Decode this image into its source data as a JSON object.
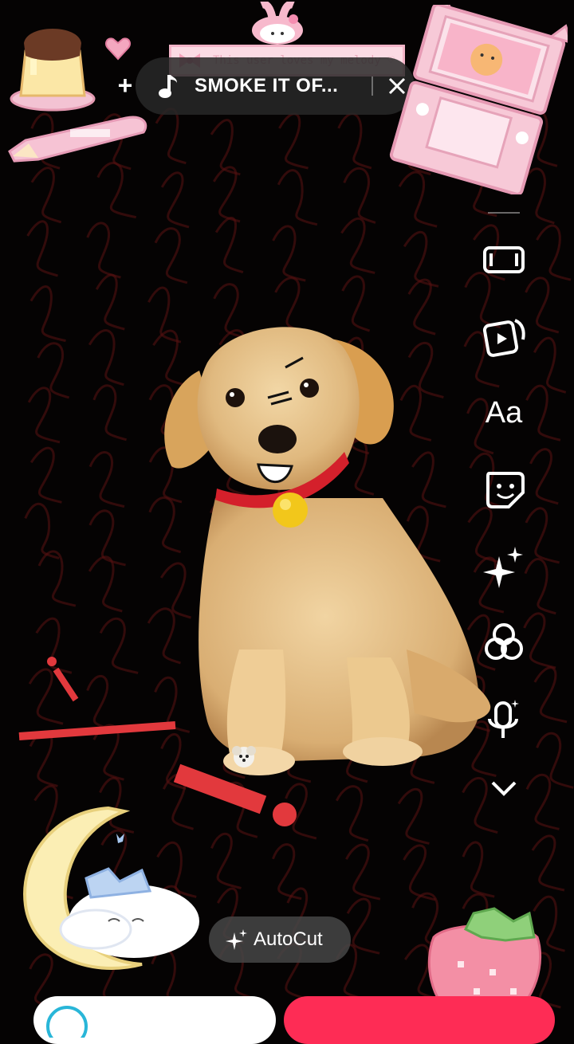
{
  "top_bar": {
    "add_sound_label": "+",
    "sound_title": "SMOKE IT OF...",
    "close_label": "×"
  },
  "melody_banner": {
    "text": "This user loves my melody ♡"
  },
  "sidebar": {
    "items": [
      {
        "name": "flip-camera",
        "icon": "flip-camera-icon"
      },
      {
        "name": "templates",
        "icon": "template-icon"
      },
      {
        "name": "text",
        "icon": "text-icon",
        "label": "Aa"
      },
      {
        "name": "stickers",
        "icon": "sticker-icon"
      },
      {
        "name": "effects",
        "icon": "sparkle-icon"
      },
      {
        "name": "filters",
        "icon": "filters-icon"
      },
      {
        "name": "voice",
        "icon": "voiceover-icon"
      },
      {
        "name": "more",
        "icon": "chevron-down-icon"
      }
    ]
  },
  "autocut": {
    "label": "AutoCut"
  },
  "colors": {
    "accent": "#fe2c55",
    "pill_bg": "#282828",
    "pink_sticker": "#f6c5d4"
  }
}
